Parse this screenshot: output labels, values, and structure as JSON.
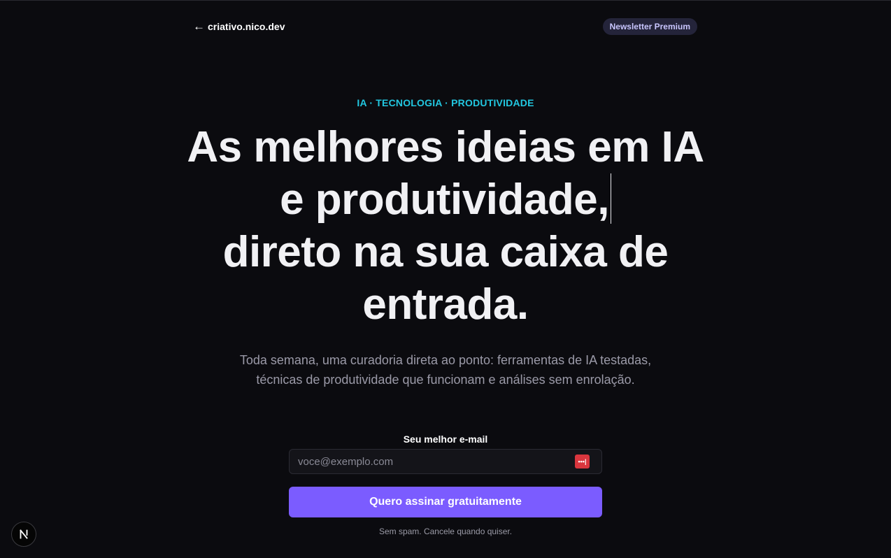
{
  "header": {
    "back_arrow": "←",
    "site_name": "criativo.nico.dev",
    "badge": "Newsletter Premium"
  },
  "hero": {
    "eyebrow": "IA · TECNOLOGIA · PRODUTIVIDADE",
    "headline_lines": [
      "As melhores ideias em IA",
      "e produtividade,",
      "direto na sua caixa de",
      "entrada."
    ],
    "subtitle": "Toda semana, uma curadoria direta ao ponto: ferramentas de IA testadas, técnicas de produtividade que funcionam e análises sem enrolação."
  },
  "form": {
    "label": "Seu melhor e-mail",
    "email_placeholder": "voce@exemplo.com",
    "email_value": "",
    "password_manager_icon": "password-manager-icon",
    "submit_label": "Quero assinar gratuitamente",
    "fineprint": "Sem spam. Cancele quando quiser."
  },
  "devtools": {
    "icon": "nextjs-logo-icon"
  },
  "colors": {
    "background": "#0b0b0f",
    "accent_cyan": "#22c7e0",
    "accent_purple": "#7b5cff",
    "badge_bg": "#24243a",
    "password_icon_red": "#d9363e"
  }
}
